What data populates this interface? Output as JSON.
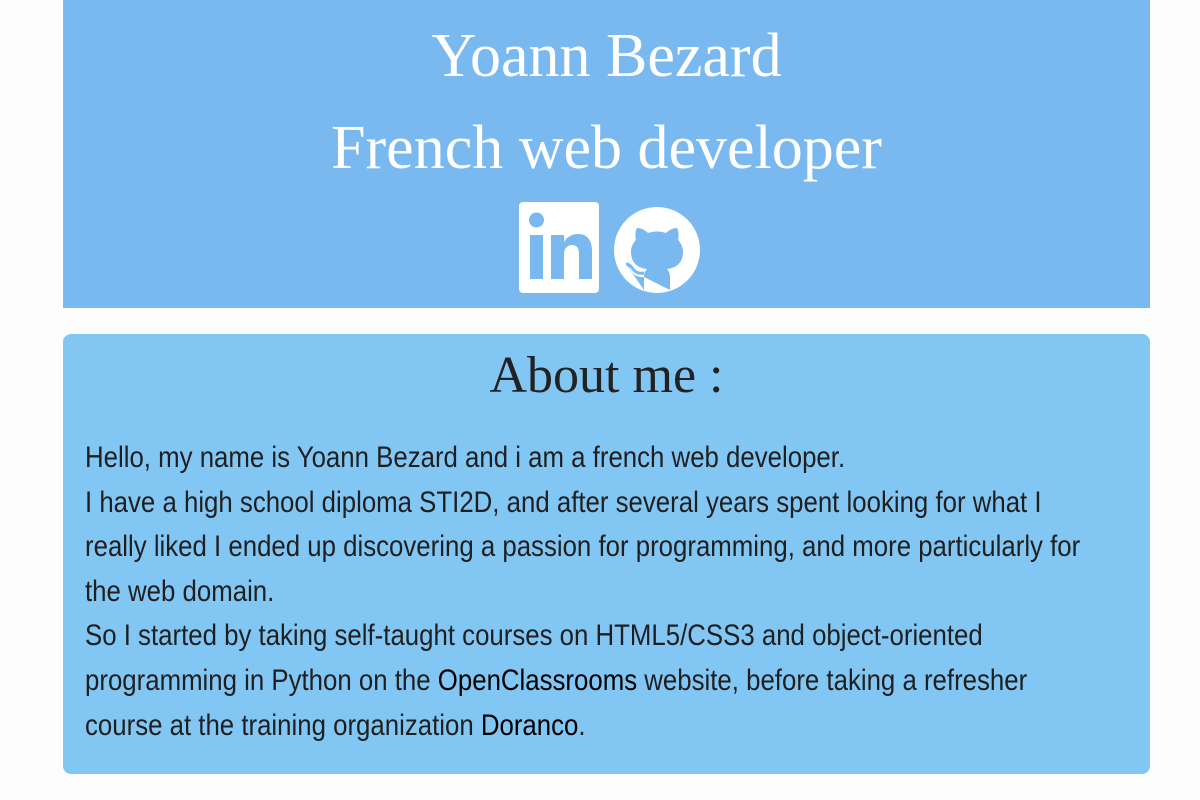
{
  "header": {
    "name": "Yoann Bezard",
    "role": "French web developer",
    "socials": [
      {
        "name": "linkedin-icon"
      },
      {
        "name": "github-icon"
      }
    ],
    "background": "#79b9f0"
  },
  "about": {
    "title": "About me :",
    "line1": "Hello, my name is Yoann Bezard and i am a french web developer.",
    "line2": "I have a high school diploma STI2D, and after several years spent looking for what I really liked I ended up discovering a passion for programming, and more particularly for the web domain.",
    "line3_before": "So I started by taking self-taught courses on HTML5/CSS3 and object-oriented programming in Python on the ",
    "link_openclassrooms": "OpenClassrooms",
    "line3_middle": " website, before taking a refresher course at the training organization ",
    "link_doranco": "Doranco",
    "line3_end": ".",
    "background": "#82c6f4"
  }
}
